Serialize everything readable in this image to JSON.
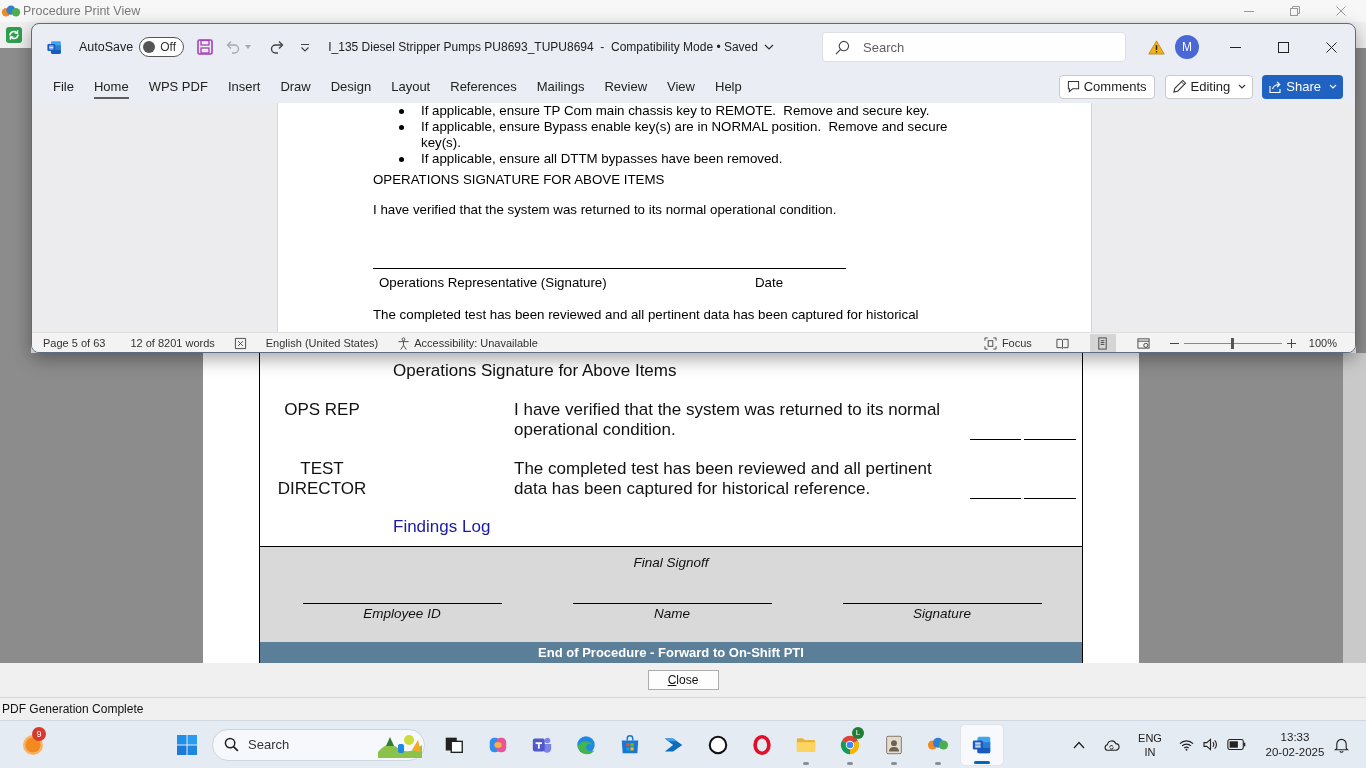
{
  "print_view": {
    "title": "Procedure Print View",
    "page": {
      "section_title": "Operations Signature for Above Items",
      "signoffs": [
        {
          "role": "OPS REP",
          "statement": "I have verified that the system was returned to its normal operational condition."
        },
        {
          "role": "TEST DIRECTOR",
          "statement": "The completed test has been reviewed and all pertinent data has been captured for historical reference."
        }
      ],
      "findings_link": "Findings Log",
      "final_signoff": {
        "title": "Final Signoff",
        "fields": [
          "Employee ID",
          "Name",
          "Signature"
        ]
      },
      "end_banner": "End of Procedure - Forward to On-Shift PTI"
    },
    "close_button": "Close",
    "status": "PDF Generation Complete"
  },
  "word": {
    "autosave": {
      "label": "AutoSave",
      "state": "Off",
      "on": false
    },
    "quick_access": [
      {
        "kind": "save",
        "disabled": false
      },
      {
        "kind": "undo",
        "disabled": true
      },
      {
        "kind": "redo",
        "disabled": false
      },
      {
        "kind": "customize",
        "disabled": false
      }
    ],
    "document_title": "I_135 Diesel Stripper Pumps PU8693_TUPU8694  -  Compatibility Mode • Saved",
    "search": {
      "placeholder": "Search"
    },
    "account": {
      "initial": "M"
    },
    "tabs": [
      {
        "label": "File",
        "selected": false
      },
      {
        "label": "Home",
        "selected": true
      },
      {
        "label": "WPS PDF",
        "selected": false
      },
      {
        "label": "Insert",
        "selected": false
      },
      {
        "label": "Draw",
        "selected": false
      },
      {
        "label": "Design",
        "selected": false
      },
      {
        "label": "Layout",
        "selected": false
      },
      {
        "label": "References",
        "selected": false
      },
      {
        "label": "Mailings",
        "selected": false
      },
      {
        "label": "Review",
        "selected": false
      },
      {
        "label": "View",
        "selected": false
      },
      {
        "label": "Help",
        "selected": false
      }
    ],
    "ribbon_actions": [
      {
        "kind": "comments",
        "label": "Comments"
      },
      {
        "kind": "editing",
        "label": "Editing"
      },
      {
        "kind": "share",
        "label": "Share"
      }
    ],
    "document": [
      {
        "kind": "bullet",
        "text": "If applicable, ensure TP Com main chassis key to REMOTE.  Remove and secure key."
      },
      {
        "kind": "bullet",
        "text": "If applicable, ensure Bypass enable key(s) are in NORMAL position.  Remove and secure key(s)."
      },
      {
        "kind": "bullet",
        "text": "If applicable, ensure all DTTM bypasses have been removed."
      },
      {
        "kind": "heading",
        "text": "OPERATIONS SIGNATURE FOR ABOVE ITEMS"
      },
      {
        "kind": "paragraph",
        "text": "I have verified that the system was returned to its normal operational condition."
      },
      {
        "kind": "signature",
        "label": "Operations Representative (Signature)",
        "date_label": "Date"
      },
      {
        "kind": "paragraph",
        "text": "The completed test has been reviewed and all pertinent data has been captured for historical"
      }
    ],
    "status_bar": {
      "page": "Page 5 of 63",
      "words": "12 of 8201 words",
      "language": "English (United States)",
      "accessibility": "Accessibility: Unavailable",
      "focus": "Focus",
      "views": [
        {
          "kind": "read",
          "selected": false
        },
        {
          "kind": "print",
          "selected": true
        },
        {
          "kind": "web",
          "selected": false
        }
      ],
      "zoom": {
        "level": 0.5,
        "reading": "100%"
      }
    }
  },
  "taskbar": {
    "widget_badge": "9",
    "search": {
      "placeholder": "Search"
    },
    "apps": [
      {
        "kind": "task-view",
        "open": false,
        "selected": false
      },
      {
        "kind": "copilot",
        "open": false,
        "selected": false
      },
      {
        "kind": "teams",
        "open": false,
        "selected": false
      },
      {
        "kind": "edge",
        "open": false,
        "selected": false
      },
      {
        "kind": "store",
        "open": false,
        "selected": false
      },
      {
        "kind": "automate",
        "open": false,
        "selected": false
      },
      {
        "kind": "dell",
        "open": false,
        "selected": false
      },
      {
        "kind": "opera",
        "open": false,
        "selected": false
      },
      {
        "kind": "explorer",
        "open": true,
        "selected": false
      },
      {
        "kind": "chrome",
        "open": true,
        "selected": false,
        "badge": "L"
      },
      {
        "kind": "portrait",
        "open": true,
        "selected": false
      },
      {
        "kind": "print-view",
        "open": true,
        "selected": false
      },
      {
        "kind": "word",
        "open": true,
        "selected": true
      }
    ],
    "tray": {
      "language": "ENG",
      "region": "IN",
      "time": "13:33",
      "date": "20-02-2025"
    }
  }
}
